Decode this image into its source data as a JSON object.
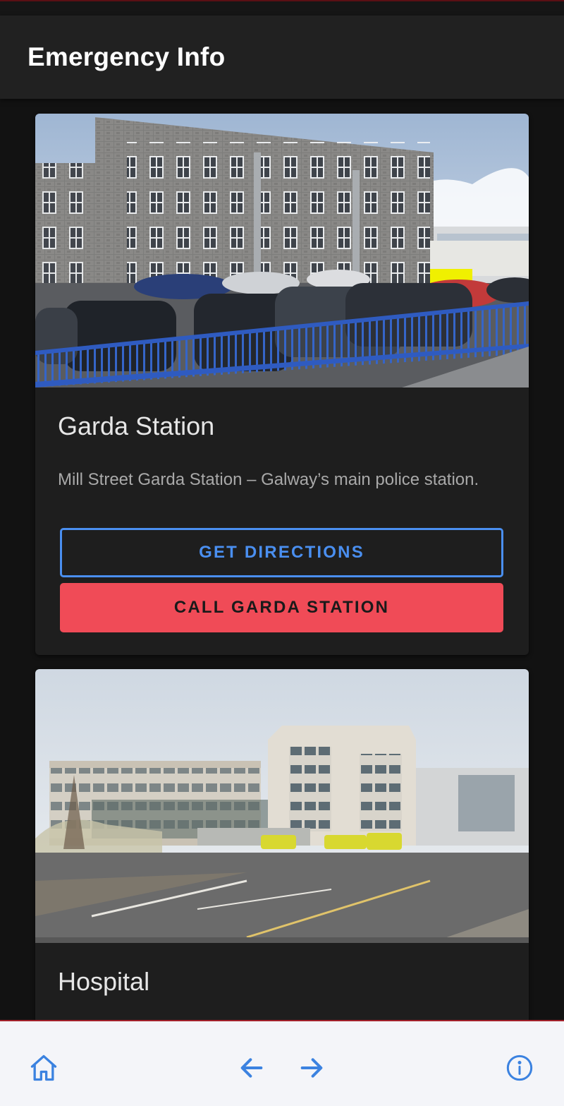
{
  "app": {
    "title": "Emergency Info"
  },
  "cards": [
    {
      "title": "Garda Station",
      "description": "Mill Street Garda Station – Galway’s main police station.",
      "directions_label": "GET DIRECTIONS",
      "call_label": "CALL GARDA STATION"
    },
    {
      "title": "Hospital"
    }
  ],
  "colors": {
    "accent": "#4a8ff0",
    "danger": "#f04b57",
    "background": "#121212",
    "card": "#1e1e1e",
    "appbar": "#212121",
    "bottom_nav": "#f4f5f9"
  },
  "bottom_nav": {
    "icons": [
      "home-icon",
      "back-arrow-icon",
      "forward-arrow-icon",
      "info-icon"
    ]
  }
}
